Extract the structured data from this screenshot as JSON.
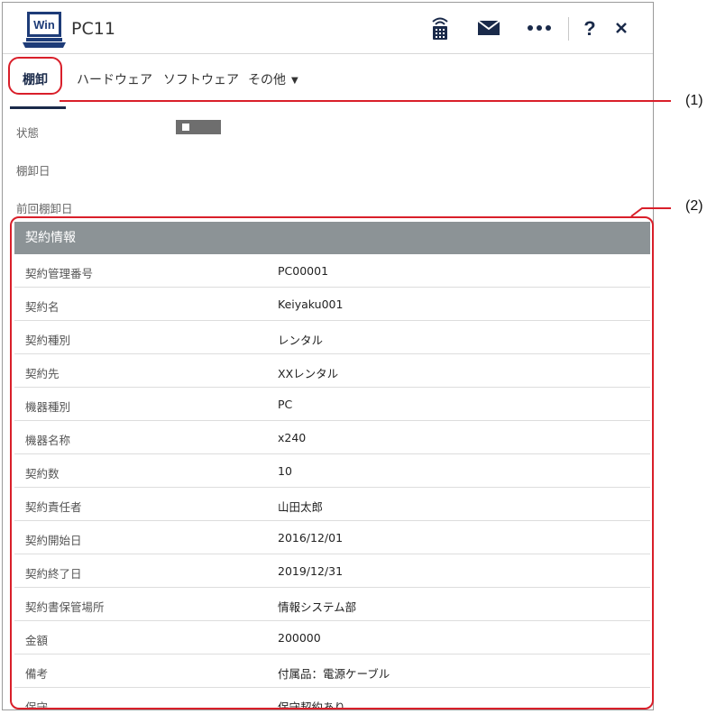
{
  "window": {
    "icon_text": "Win",
    "title": "PC11"
  },
  "header_icons": [
    "remote-control-icon",
    "mail-icon",
    "more-icon",
    "help-icon",
    "close-icon"
  ],
  "tabs": [
    {
      "label": "棚卸",
      "active": true
    },
    {
      "label": "ハードウェア",
      "active": false
    },
    {
      "label": "ソフトウェア",
      "active": false
    },
    {
      "label": "その他",
      "active": false
    }
  ],
  "status": {
    "state_label": "状態",
    "inventory_date_label": "棚卸日",
    "previous_inventory_date_label": "前回棚卸日"
  },
  "contract": {
    "header": "契約情報",
    "rows": [
      {
        "label": "契約管理番号",
        "value": "PC00001"
      },
      {
        "label": "契約名",
        "value": "Keiyaku001"
      },
      {
        "label": "契約種別",
        "value": "レンタル"
      },
      {
        "label": "契約先",
        "value": "XXレンタル"
      },
      {
        "label": "機器種別",
        "value": "PC"
      },
      {
        "label": "機器名称",
        "value": "x240"
      },
      {
        "label": "契約数",
        "value": "10"
      },
      {
        "label": "契約責任者",
        "value": "山田太郎"
      },
      {
        "label": "契約開始日",
        "value": "2016/12/01"
      },
      {
        "label": "契約終了日",
        "value": "2019/12/31"
      },
      {
        "label": "契約書保管場所",
        "value": "情報システム部"
      },
      {
        "label": "金額",
        "value": "200000"
      },
      {
        "label": "備考",
        "value": "付属品：電源ケーブル"
      },
      {
        "label": "保守",
        "value": "保守契約あり"
      }
    ]
  },
  "annotations": {
    "callout_1": "(1)",
    "callout_2": "(2)",
    "color": "#d91f2a"
  }
}
